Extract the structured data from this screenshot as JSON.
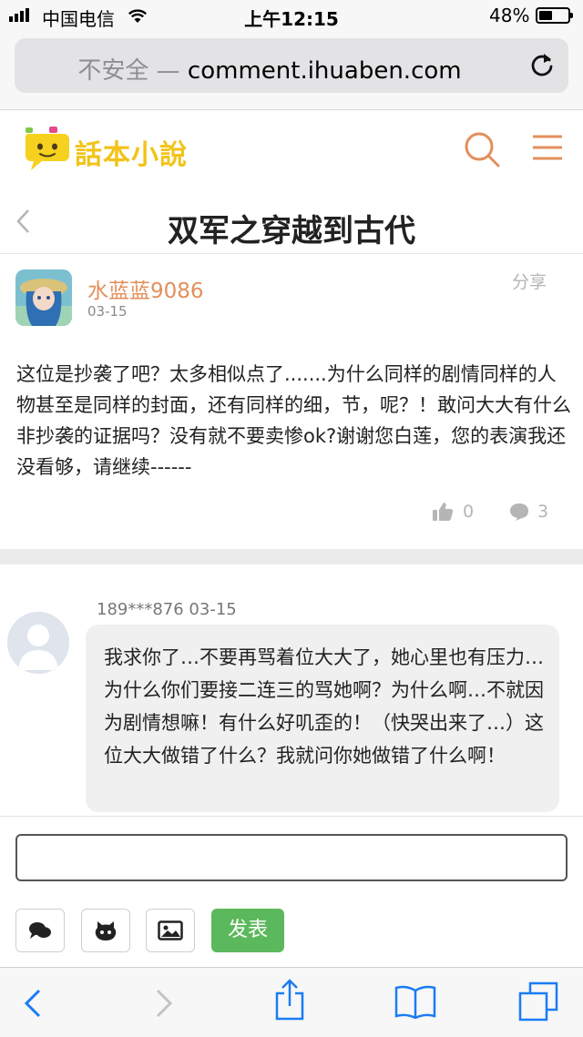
{
  "status_bar": {
    "carrier": "中国电信",
    "time": "上午12:15",
    "battery": "48%"
  },
  "browser": {
    "url_prefix": "不安全 — ",
    "url_domain": "comment.ihuaben.com"
  },
  "site": {
    "brand": "話本小說"
  },
  "page": {
    "title": "双军之穿越到古代"
  },
  "post": {
    "author": "水蓝蓝9086",
    "date": "03-15",
    "share_label": "分享",
    "content": "这位是抄袭了吧？太多相似点了.......为什么同样的剧情同样的人物甚至是同样的封面，还有同样的细，节，呢？！敢问大大有什么非抄袭的证据吗？没有就不要卖惨ok?谢谢您白莲，您的表演我还没看够，请继续------",
    "likes": "0",
    "replies": "3"
  },
  "comment": {
    "meta": "189***876 03-15",
    "text": "我求你了…不要再骂着位大大了，她心里也有压力…为什么你们要接二连三的骂她啊？为什么啊…不就因为剧情想嘛！有什么好叽歪的！（快哭出来了…）这位大大做错了什么？我就问你她做错了什么啊！"
  },
  "composer": {
    "post_button": "发表"
  },
  "colors": {
    "accent": "#e38f5b",
    "brand_yellow": "#f2c318",
    "post_green": "#5cb85c",
    "ios_blue": "#1a7cf5"
  }
}
